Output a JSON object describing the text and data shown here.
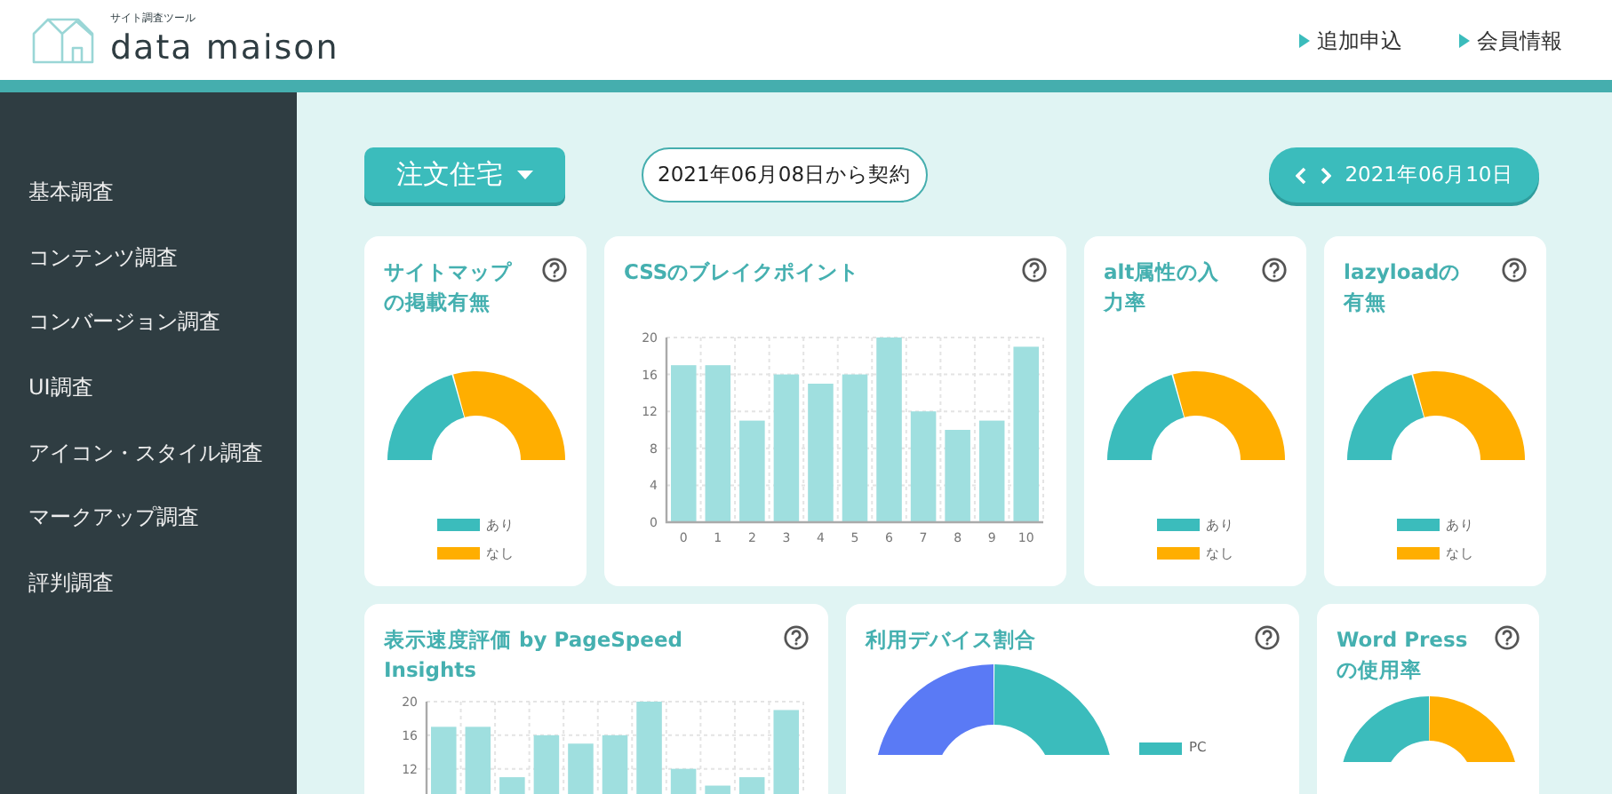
{
  "header": {
    "tagline": "サイト調査ツール",
    "logo_name": "data maison",
    "links": [
      {
        "label": "追加申込"
      },
      {
        "label": "会員情報"
      }
    ]
  },
  "sidebar": {
    "items": [
      {
        "label": "基本調査"
      },
      {
        "label": "コンテンツ調査"
      },
      {
        "label": "コンバージョン調査"
      },
      {
        "label": "UI調査"
      },
      {
        "label": "アイコン・スタイル調査"
      },
      {
        "label": "マークアップ調査"
      },
      {
        "label": "評判調査"
      }
    ]
  },
  "toolbar": {
    "category_button": "注文住宅",
    "contract": "2021年06月08日から契約",
    "date": "2021年06月10日"
  },
  "cards": [
    {
      "kind": "half-donut",
      "title": "サイトマップの掲載有無",
      "legend": [
        {
          "label": "あり",
          "color": "#3bbcbc"
        },
        {
          "label": "なし",
          "color": "#ffae00"
        }
      ]
    },
    {
      "kind": "bar",
      "title": "CSSのブレイクポイント",
      "chart_data": {
        "type": "bar",
        "categories": [
          "0",
          "1",
          "2",
          "3",
          "4",
          "5",
          "6",
          "7",
          "8",
          "9",
          "10"
        ],
        "series": [
          {
            "color": "#9fdfdf",
            "values": [
              17,
              17,
              11,
              16,
              15,
              16,
              20,
              12,
              10,
              11,
              19
            ]
          }
        ],
        "ylim": [
          0,
          20
        ],
        "yticks": [
          0,
          4,
          8,
          12,
          16,
          20
        ],
        "grid": true
      }
    },
    {
      "kind": "half-donut",
      "title": "alt属性の入力率",
      "legend": [
        {
          "label": "あり",
          "color": "#3bbcbc"
        },
        {
          "label": "なし",
          "color": "#ffae00"
        }
      ]
    },
    {
      "kind": "half-donut",
      "title": "lazyloadの有無",
      "legend": [
        {
          "label": "あり",
          "color": "#3bbcbc"
        },
        {
          "label": "なし",
          "color": "#ffae00"
        }
      ]
    },
    {
      "kind": "bar",
      "title": "表示速度評価 by PageSpeed Insights",
      "chart_data": {
        "type": "bar",
        "series": [
          {
            "color": "#9fdfdf",
            "values": [
              17,
              17,
              11,
              16,
              15,
              16,
              20,
              12,
              10,
              11,
              19
            ]
          }
        ],
        "ylim": [
          9,
          20
        ],
        "yticks": [
          12,
          16,
          20
        ],
        "grid": true
      }
    },
    {
      "kind": "device-donut",
      "title": "利用デバイス割合",
      "legend": [
        {
          "label": "PC",
          "color": "#3bbcbc"
        }
      ]
    },
    {
      "kind": "ratio-donut",
      "title": "Word Pressの使用率"
    }
  ]
}
